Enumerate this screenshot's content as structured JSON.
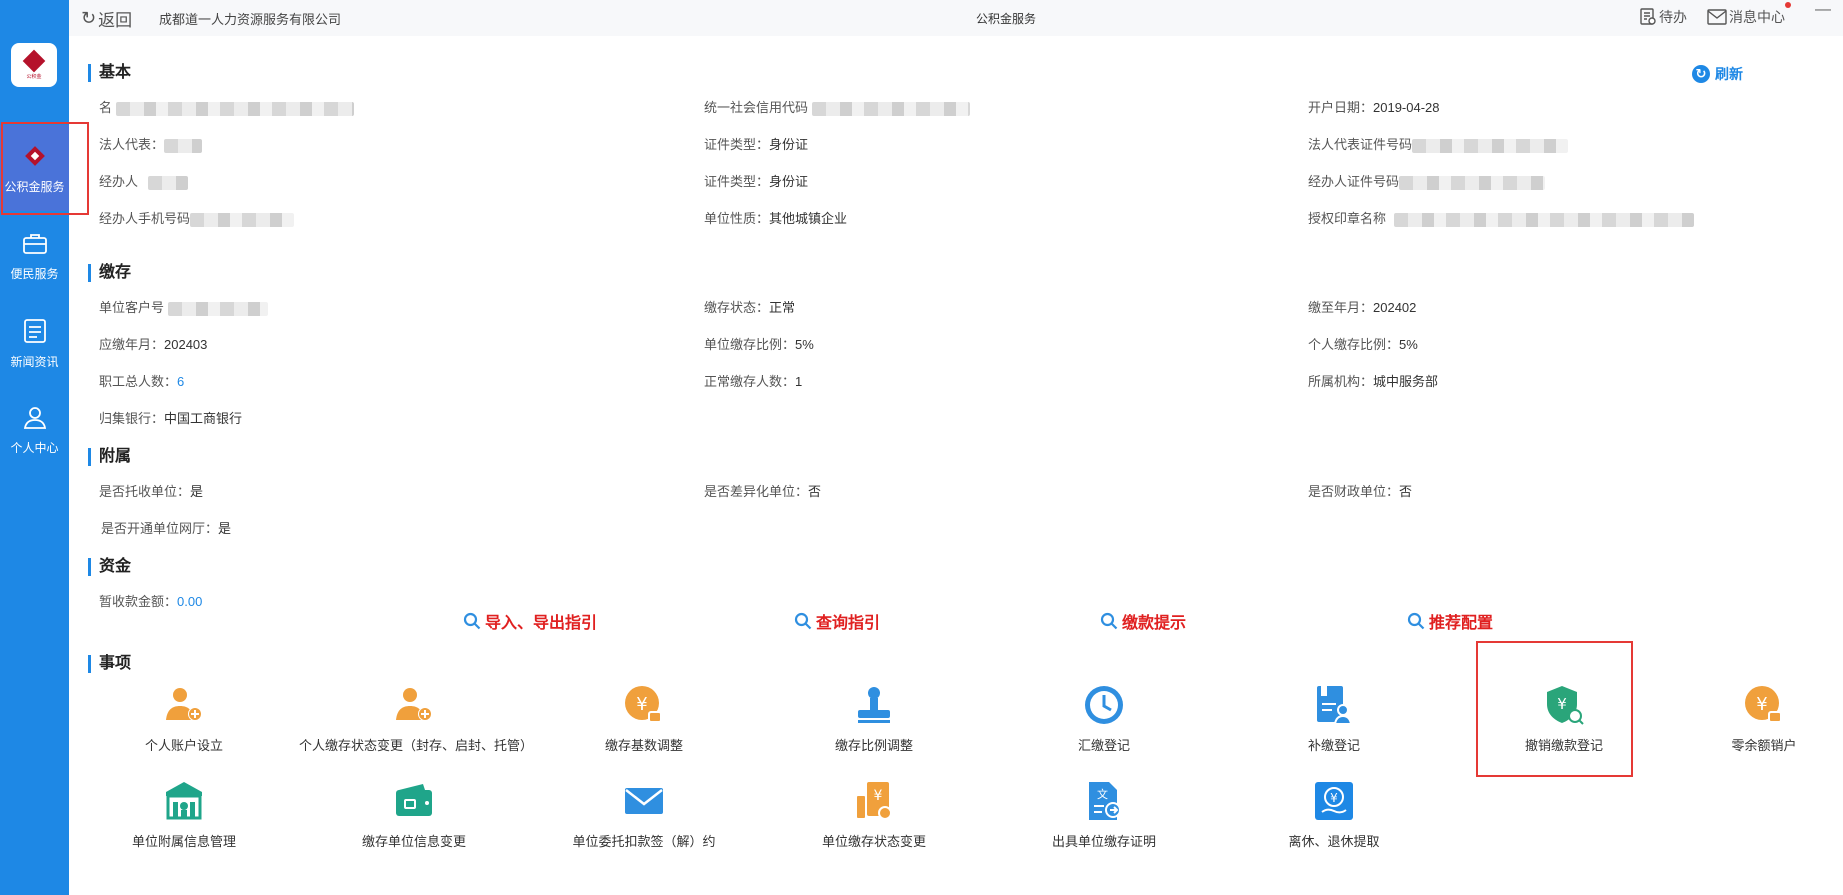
{
  "sidebar": {
    "items": [
      {
        "label": "公积金服务",
        "active": true
      },
      {
        "label": "便民服务"
      },
      {
        "label": "新闻资讯"
      },
      {
        "label": "个人中心"
      }
    ]
  },
  "topbar": {
    "back_label": "返回",
    "company": "成都道一人力资源服务有限公司",
    "title": "公积金服务",
    "todo_label": "待办",
    "message_label": "消息中心"
  },
  "refresh_label": "刷新",
  "sections": {
    "basic": {
      "title": "基本",
      "name_label": "名",
      "credit_code_label": "统一社会信用代码",
      "open_date_label": "开户日期：",
      "open_date": "2019-04-28",
      "legal_rep_label": "法人代表：",
      "cert_type_label1": "证件类型：",
      "cert_type1": "身份证",
      "legal_cert_label": "法人代表证件号码",
      "handler_label": "经办人",
      "cert_type_label2": "证件类型：",
      "cert_type2": "身份证",
      "handler_cert_label": "经办人证件号码",
      "handler_phone_label": "经办人手机号码",
      "unit_nature_label": "单位性质：",
      "unit_nature": "其他城镇企业",
      "seal_label": "授权印章名称"
    },
    "deposit": {
      "title": "缴存",
      "customer_no_label": "单位客户号",
      "status_label": "缴存状态：",
      "status": "正常",
      "paid_until_label": "缴至年月：",
      "paid_until": "202402",
      "due_month_label": "应缴年月：",
      "due_month": "202403",
      "unit_ratio_label": "单位缴存比例：",
      "unit_ratio": "5%",
      "person_ratio_label": "个人缴存比例：",
      "person_ratio": "5%",
      "total_staff_label": "职工总人数：",
      "total_staff": "6",
      "normal_staff_label": "正常缴存人数：",
      "normal_staff": "1",
      "org_label": "所属机构：",
      "org": "城中服务部",
      "bank_label": "归集银行：",
      "bank": "中国工商银行"
    },
    "attached": {
      "title": "附属",
      "entrust_label": "是否托收单位：",
      "entrust": "是",
      "diff_label": "是否差异化单位：",
      "diff": "否",
      "finance_label": "是否财政单位：",
      "finance": "否",
      "hall_label": "是否开通单位网厅：",
      "hall": "是"
    },
    "funds": {
      "title": "资金",
      "temp_label": "暂收款金额：",
      "temp": "0.00"
    },
    "items": {
      "title": "事项"
    }
  },
  "guides": [
    "导入、导出指引",
    "查询指引",
    "缴款提示",
    "推荐配置"
  ],
  "items_row1": [
    {
      "label": "个人账户设立",
      "icon": "person-add-icon",
      "color": "#f0a03c"
    },
    {
      "label": "个人缴存状态变更（封存、启封、托管）",
      "icon": "person-add-icon",
      "color": "#f0a03c"
    },
    {
      "label": "缴存基数调整",
      "icon": "yen-lock-icon",
      "color": "#f0a03c"
    },
    {
      "label": "缴存比例调整",
      "icon": "stamp-icon",
      "color": "#2f8fe0"
    },
    {
      "label": "汇缴登记",
      "icon": "clock-icon",
      "color": "#2f8fe0"
    },
    {
      "label": "补缴登记",
      "icon": "doc-person-icon",
      "color": "#2f8fe0"
    },
    {
      "label": "撤销缴款登记",
      "icon": "shield-yen-icon",
      "color": "#2aa57a"
    },
    {
      "label": "零余额销户",
      "icon": "yen-lock-icon",
      "color": "#f0a03c"
    }
  ],
  "items_row2": [
    {
      "label": "单位附属信息管理",
      "icon": "building-icon",
      "color": "#1fa58a"
    },
    {
      "label": "缴存单位信息变更",
      "icon": "wallet-icon",
      "color": "#1fa58a"
    },
    {
      "label": "单位委托扣款签（解）约",
      "icon": "mail-icon",
      "color": "#2f8fe0"
    },
    {
      "label": "单位缴存状态变更",
      "icon": "yen-doc-icon",
      "color": "#f0a03c"
    },
    {
      "label": "出具单位缴存证明",
      "icon": "doc-arrow-icon",
      "color": "#2f8fe0"
    },
    {
      "label": "离休、退休提取",
      "icon": "coin-hand-icon",
      "color": "#1e88e5"
    }
  ]
}
